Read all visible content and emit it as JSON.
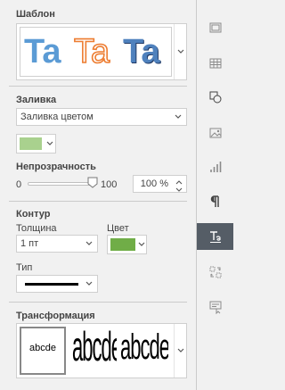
{
  "template": {
    "title": "Шаблон",
    "sample_text": "Ta",
    "samples": [
      {
        "color": "#5b9bd5"
      },
      {
        "color": "#ed7d31"
      },
      {
        "color": "#4f81bd"
      }
    ]
  },
  "fill": {
    "title": "Заливка",
    "type_value": "Заливка цветом",
    "color": "#a9d18e",
    "opacity_label": "Непрозрачность",
    "min": "0",
    "max": "100",
    "value_text": "100 %",
    "value": 100
  },
  "stroke": {
    "title": "Контур",
    "width_label": "Толщина",
    "width_value": "1 пт",
    "color_label": "Цвет",
    "color": "#70ad47",
    "type_label": "Тип"
  },
  "transform": {
    "title": "Трансформация",
    "items": [
      "abcde",
      "abcde",
      "abcde"
    ]
  },
  "rail": {
    "items": [
      "slide-settings",
      "table-settings",
      "shape-settings",
      "image-settings",
      "chart-settings",
      "paragraph-settings",
      "textart-settings",
      "signature-settings",
      "form-settings"
    ]
  }
}
